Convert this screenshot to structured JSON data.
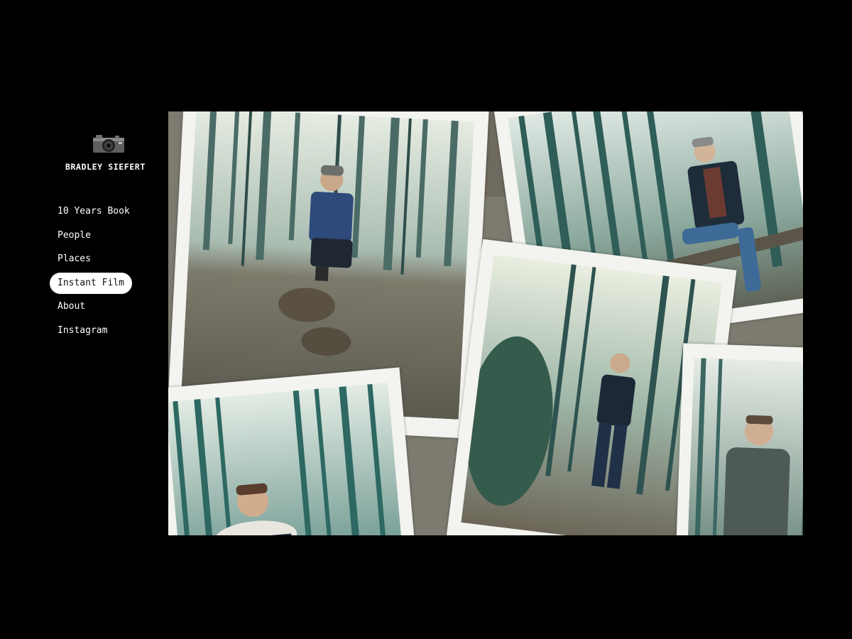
{
  "site": {
    "name": "BRADLEY SIEFERT",
    "logo_icon": "camera-icon"
  },
  "nav": {
    "items": [
      {
        "label": "10 Years Book",
        "active": false
      },
      {
        "label": "People",
        "active": false
      },
      {
        "label": "Places",
        "active": false
      },
      {
        "label": "Instant Film",
        "active": true
      },
      {
        "label": "About",
        "active": false
      },
      {
        "label": "Instagram",
        "active": false
      }
    ]
  },
  "gallery": {
    "photos": [
      {
        "subject": "man crouching in forest"
      },
      {
        "subject": "man seated on log in forest"
      },
      {
        "subject": "man standing in forest"
      },
      {
        "subject": "man in parka smoking"
      },
      {
        "subject": "man in grey jacket sitting"
      }
    ]
  },
  "colors": {
    "background": "#000000",
    "text": "#ffffff",
    "active_pill": "#ffffff",
    "polaroid_border": "#f3f3ef",
    "film_tint": "#3f7d7a"
  }
}
